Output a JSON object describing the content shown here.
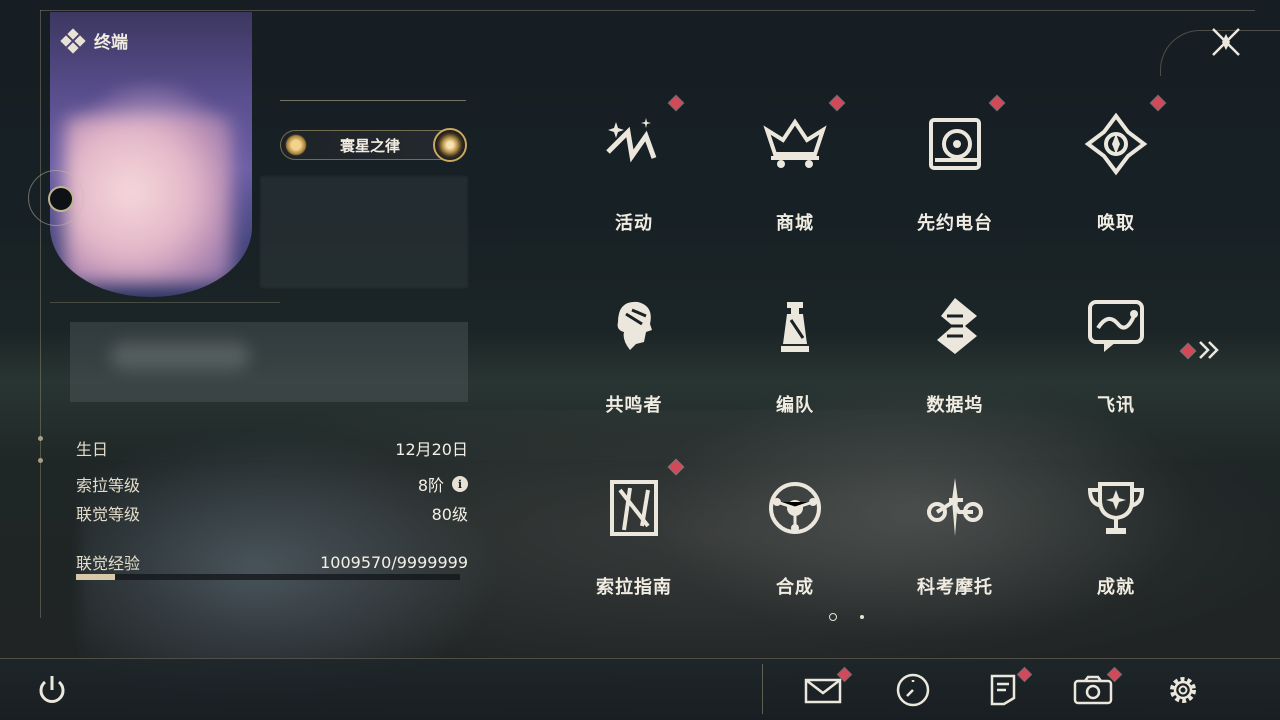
{
  "header": {
    "title": "终端"
  },
  "profile": {
    "tag_label": "寰星之律",
    "stats": [
      {
        "label": "生日",
        "value": "12月20日"
      },
      {
        "label": "索拉等级",
        "value": "8阶"
      },
      {
        "label": "联觉等级",
        "value": "80级"
      },
      {
        "label": "联觉经验",
        "value": "1009570/9999999"
      }
    ],
    "xp_progress": 0.101
  },
  "menu": {
    "items": [
      {
        "label": "活动",
        "icon": "activity-icon",
        "badge": true
      },
      {
        "label": "商城",
        "icon": "shop-icon",
        "badge": true
      },
      {
        "label": "先约电台",
        "icon": "radio-icon",
        "badge": true
      },
      {
        "label": "唤取",
        "icon": "convene-icon",
        "badge": true
      },
      {
        "label": "共鸣者",
        "icon": "resonator-icon",
        "badge": false
      },
      {
        "label": "编队",
        "icon": "team-icon",
        "badge": false
      },
      {
        "label": "数据坞",
        "icon": "data-bank-icon",
        "badge": false
      },
      {
        "label": "飞讯",
        "icon": "message-icon",
        "badge": false
      },
      {
        "label": "索拉指南",
        "icon": "guidebook-icon",
        "badge": true
      },
      {
        "label": "合成",
        "icon": "synthesis-icon",
        "badge": false
      },
      {
        "label": "科考摩托",
        "icon": "motorcycle-icon",
        "badge": false
      },
      {
        "label": "成就",
        "icon": "trophy-icon",
        "badge": false
      }
    ],
    "next_page_badge": true,
    "current_page": 1,
    "page_count": 2
  },
  "bottom_bar": {
    "buttons": [
      {
        "icon": "power-icon",
        "badge": false
      },
      {
        "icon": "mail-icon",
        "badge": true
      },
      {
        "icon": "clock-icon",
        "badge": false
      },
      {
        "icon": "notice-icon",
        "badge": true
      },
      {
        "icon": "camera-icon",
        "badge": true
      },
      {
        "icon": "settings-icon",
        "badge": false
      }
    ]
  },
  "colors": {
    "badge": "#d24a5a",
    "text": "#ece7dc",
    "accent_gold": "#c9a860"
  }
}
